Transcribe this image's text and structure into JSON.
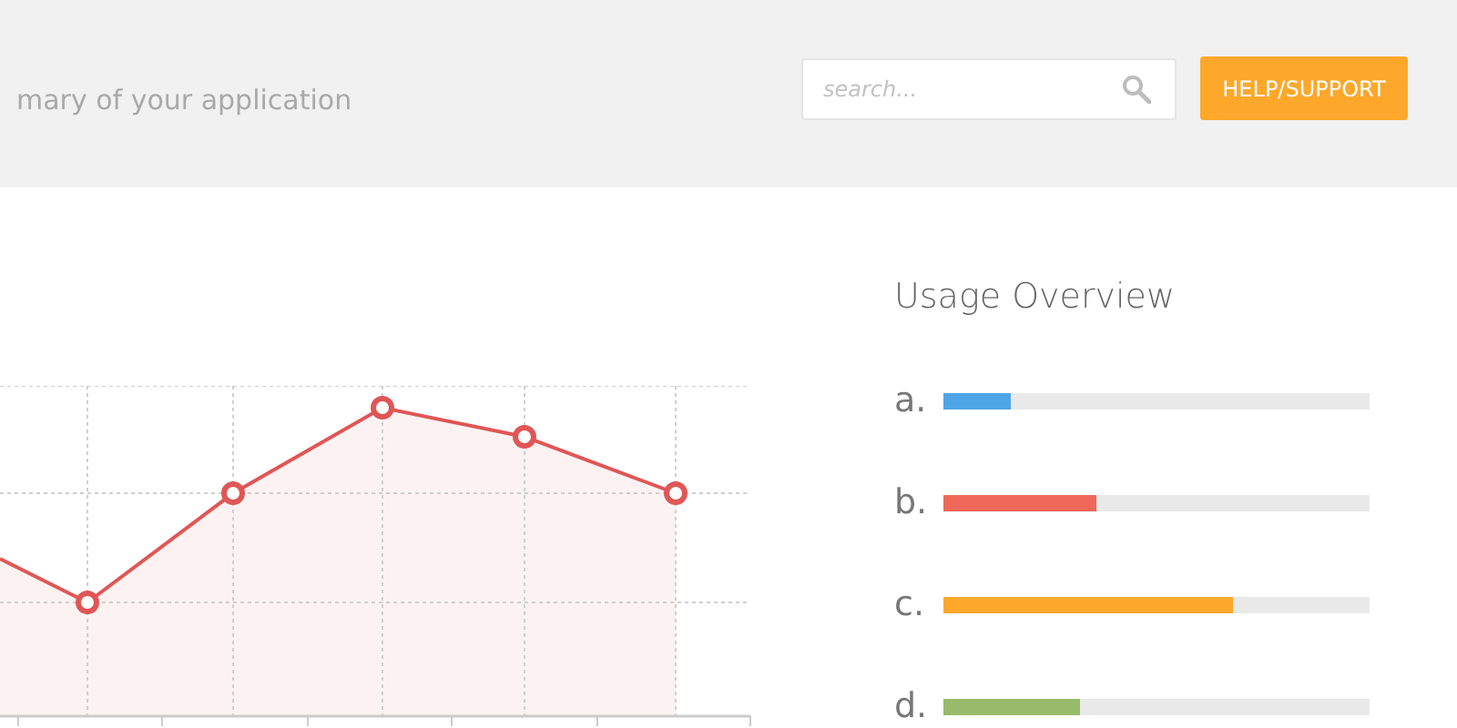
{
  "header": {
    "subtitle": "mary of your application",
    "search": {
      "placeholder": "search..."
    },
    "help_button": "HELP/SUPPORT"
  },
  "usage": {
    "title": "Usage Overview",
    "bars": [
      {
        "label": "a.",
        "level": 0.16,
        "color": "#4ea5e6"
      },
      {
        "label": "b.",
        "level": 0.36,
        "color": "#f0685a"
      },
      {
        "label": "c.",
        "level": 0.68,
        "color": "#fda82a"
      },
      {
        "label": "d.",
        "level": 0.32,
        "color": "#97bb6b"
      }
    ]
  }
}
